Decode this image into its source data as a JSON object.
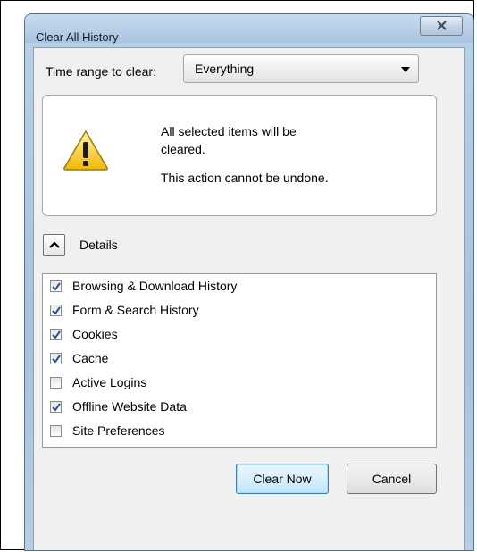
{
  "window": {
    "title": "Clear All History"
  },
  "time_range": {
    "label": "Time range to clear:",
    "selected": "Everything"
  },
  "warning": {
    "line1": "All selected items will be cleared.",
    "line2": "This action cannot be undone."
  },
  "details": {
    "label": "Details",
    "expanded": true
  },
  "items": [
    {
      "label": "Browsing & Download History",
      "checked": true
    },
    {
      "label": "Form & Search History",
      "checked": true
    },
    {
      "label": "Cookies",
      "checked": true
    },
    {
      "label": "Cache",
      "checked": true
    },
    {
      "label": "Active Logins",
      "checked": false
    },
    {
      "label": "Offline Website Data",
      "checked": true
    },
    {
      "label": "Site Preferences",
      "checked": false
    }
  ],
  "buttons": {
    "clear_now": "Clear Now",
    "cancel": "Cancel"
  },
  "icons": {
    "warning": "warning-icon",
    "close": "close-icon",
    "chevron": "chevron-up-icon"
  },
  "colors": {
    "warning_yellow": "#f5c518",
    "checkmark_blue": "#2a4f8f"
  }
}
